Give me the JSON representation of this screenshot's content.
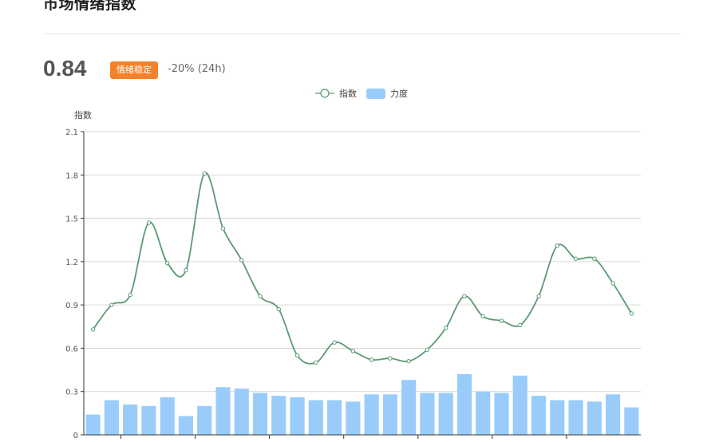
{
  "header": {
    "title": "市场情绪指数",
    "index_value": "0.84",
    "badge": "情绪稳定",
    "change": "-20% (24h)"
  },
  "legend": {
    "line_label": "指数",
    "bar_label": "力度"
  },
  "colors": {
    "line": "#5b9a72",
    "bar": "#99ccfa",
    "badge": "#f5822a",
    "grid": "#cccccc"
  },
  "chart_data": {
    "type": "bar",
    "ylabel": "指数",
    "ylim": [
      0,
      2.1
    ],
    "yticks": [
      "0",
      "0.3",
      "0.6",
      "0.9",
      "1.2",
      "1.5",
      "1.8",
      "2.1"
    ],
    "grid": true,
    "legend_position": "top-center",
    "series": [
      {
        "name": "指数",
        "type": "line",
        "values": [
          0.73,
          0.9,
          0.97,
          1.47,
          1.19,
          1.14,
          1.81,
          1.43,
          1.21,
          0.96,
          0.87,
          0.55,
          0.5,
          0.64,
          0.58,
          0.52,
          0.53,
          0.51,
          0.59,
          0.74,
          0.96,
          0.82,
          0.79,
          0.76,
          0.96,
          1.31,
          1.22,
          1.22,
          1.05,
          0.84
        ]
      },
      {
        "name": "力度",
        "type": "bar",
        "values": [
          0.14,
          0.24,
          0.21,
          0.2,
          0.26,
          0.13,
          0.2,
          0.33,
          0.32,
          0.29,
          0.27,
          0.26,
          0.24,
          0.24,
          0.23,
          0.28,
          0.28,
          0.38,
          0.29,
          0.29,
          0.42,
          0.3,
          0.29,
          0.41,
          0.27,
          0.24,
          0.24,
          0.23,
          0.28,
          0.19
        ]
      }
    ]
  }
}
